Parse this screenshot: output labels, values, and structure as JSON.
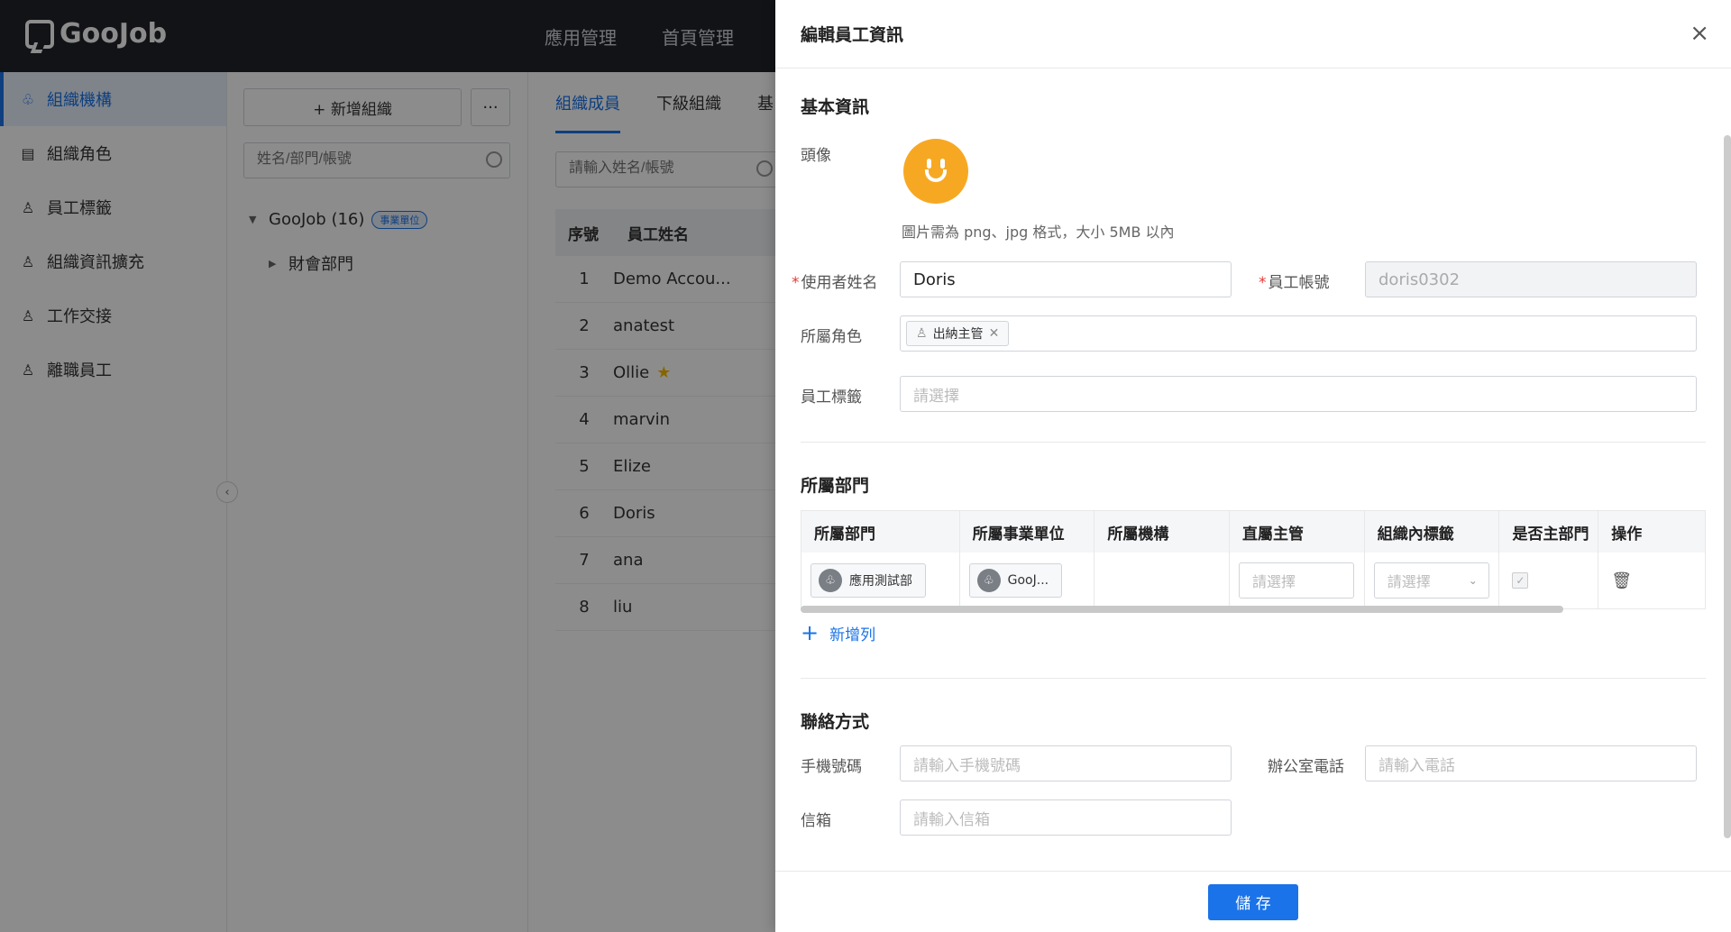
{
  "header": {
    "logo": "GooJob",
    "nav": [
      "應用管理",
      "首頁管理"
    ]
  },
  "sidebar": {
    "items": [
      {
        "label": "組織機構",
        "icon": "org-icon"
      },
      {
        "label": "組織角色",
        "icon": "role-icon"
      },
      {
        "label": "員工標籤",
        "icon": "tag-person-icon"
      },
      {
        "label": "組織資訊擴充",
        "icon": "person-icon"
      },
      {
        "label": "工作交接",
        "icon": "person-icon"
      },
      {
        "label": "離職員工",
        "icon": "person-icon"
      }
    ],
    "active_index": 0
  },
  "tree_panel": {
    "add_button": "+ 新增組織",
    "more_button": "···",
    "search_placeholder": "姓名/部門/帳號",
    "root": {
      "label": "GooJob (16)",
      "badge": "事業單位"
    },
    "child": {
      "label": "財會部門"
    }
  },
  "content": {
    "tabs": [
      "組織成員",
      "下級組織",
      "基"
    ],
    "active_tab": 0,
    "search_placeholder": "請輸入姓名/帳號",
    "table": {
      "headers": [
        "序號",
        "員工姓名"
      ],
      "rows": [
        {
          "no": "1",
          "name": "Demo Accou..."
        },
        {
          "no": "2",
          "name": "anatest"
        },
        {
          "no": "3",
          "name": "Ollie",
          "star": true
        },
        {
          "no": "4",
          "name": "marvin"
        },
        {
          "no": "5",
          "name": "Elize"
        },
        {
          "no": "6",
          "name": "Doris"
        },
        {
          "no": "7",
          "name": "ana"
        },
        {
          "no": "8",
          "name": "liu"
        }
      ]
    }
  },
  "drawer": {
    "title": "編輯員工資訊",
    "close": "×",
    "basic": {
      "section_title": "基本資訊",
      "avatar_label": "頭像",
      "avatar_hint": "圖片需為 png、jpg 格式，大小 5MB 以內",
      "username_label": "使用者姓名",
      "username_value": "Doris",
      "account_label": "員工帳號",
      "account_value": "doris0302",
      "role_label": "所屬角色",
      "role_tag": "出納主管",
      "tag_label": "員工標籤",
      "tag_placeholder": "請選擇"
    },
    "dept": {
      "section_title": "所屬部門",
      "headers": [
        "所屬部門",
        "所屬事業單位",
        "所屬機構",
        "直屬主管",
        "組織內標籤",
        "是否主部門",
        "操作"
      ],
      "row": {
        "dept": "應用測試部",
        "unit": "GooJ...",
        "org": "",
        "manager_placeholder": "請選擇",
        "label_placeholder": "請選擇",
        "is_main": true
      },
      "add_row": "新增列"
    },
    "contact": {
      "section_title": "聯絡方式",
      "phone_label": "手機號碼",
      "phone_placeholder": "請輸入手機號碼",
      "office_label": "辦公室電話",
      "office_placeholder": "請輸入電話",
      "email_label": "信箱",
      "email_placeholder": "請輸入信箱"
    },
    "save": "儲 存"
  },
  "colors": {
    "accent": "#1a73e8",
    "topbar": "#1f2329",
    "avatar": "#f7a823",
    "required": "#e53935"
  }
}
